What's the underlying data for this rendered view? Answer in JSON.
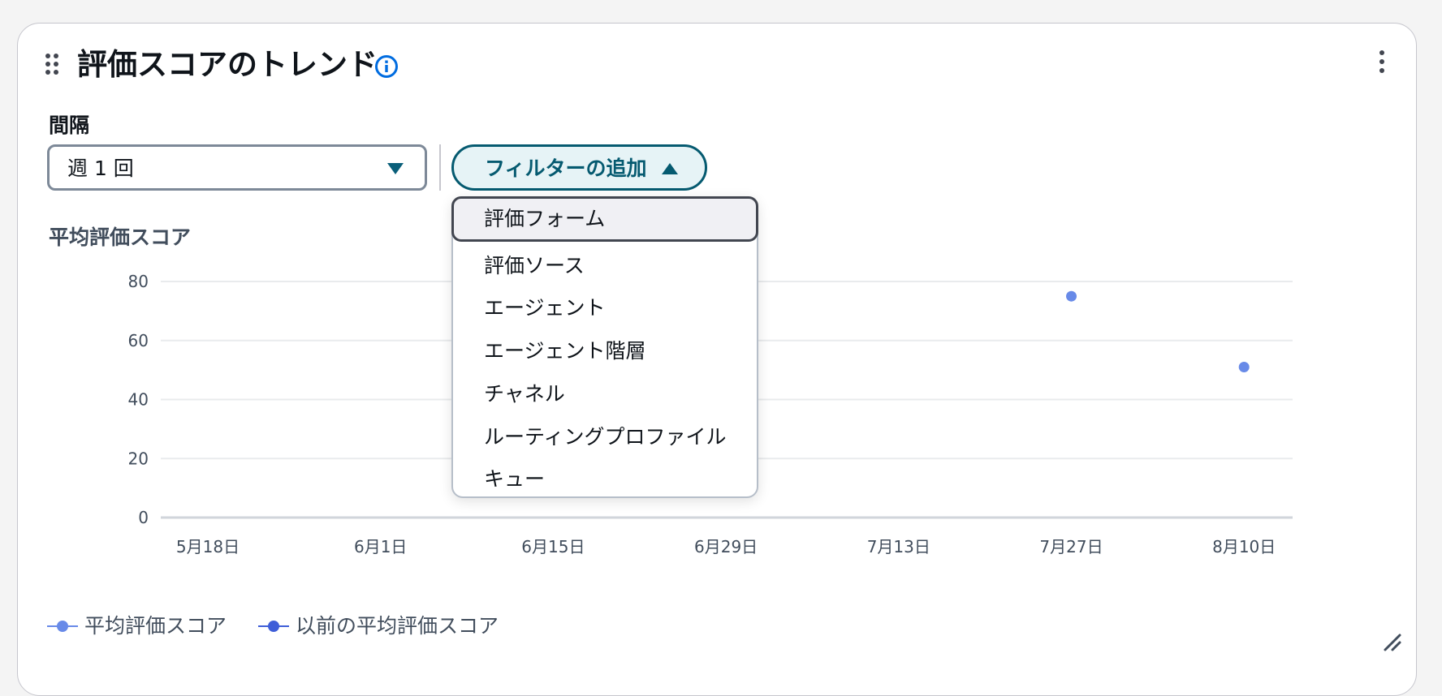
{
  "widget": {
    "title": "評価スコアのトレンド",
    "interval_label": "間隔",
    "interval_value": "週 1 回",
    "filter_button_label": "フィルターの追加",
    "chart_title": "平均評価スコア"
  },
  "filter_menu": {
    "items": [
      "評価フォーム",
      "評価ソース",
      "エージェント",
      "エージェント階層",
      "チャネル",
      "ルーティングプロファイル",
      "キュー"
    ],
    "highlighted_index": 0
  },
  "legend": {
    "items": [
      "平均評価スコア",
      "以前の平均評価スコア"
    ]
  },
  "colors": {
    "accent": "#055a70",
    "series_current": "#688ae8",
    "series_previous": "#3f5ed8",
    "info": "#006ce0"
  },
  "icons": [
    "drag-handle-icon",
    "info-icon",
    "more-options-icon",
    "dropdown-caret-icon",
    "caret-up-icon",
    "resize-handle-icon"
  ],
  "chart_data": {
    "type": "scatter",
    "title": "平均評価スコア",
    "xlabel": "",
    "ylabel": "",
    "categories": [
      "5月18日",
      "6月1日",
      "6月15日",
      "6月29日",
      "7月13日",
      "7月27日",
      "8月10日"
    ],
    "yticks": [
      0,
      20,
      40,
      60,
      80
    ],
    "ylim": [
      0,
      80
    ],
    "grid": true,
    "legend_position": "bottom-left",
    "series": [
      {
        "name": "平均評価スコア",
        "values": [
          null,
          null,
          null,
          null,
          null,
          75,
          51
        ]
      },
      {
        "name": "以前の平均評価スコア",
        "values": [
          null,
          null,
          null,
          null,
          null,
          null,
          null
        ]
      }
    ]
  }
}
